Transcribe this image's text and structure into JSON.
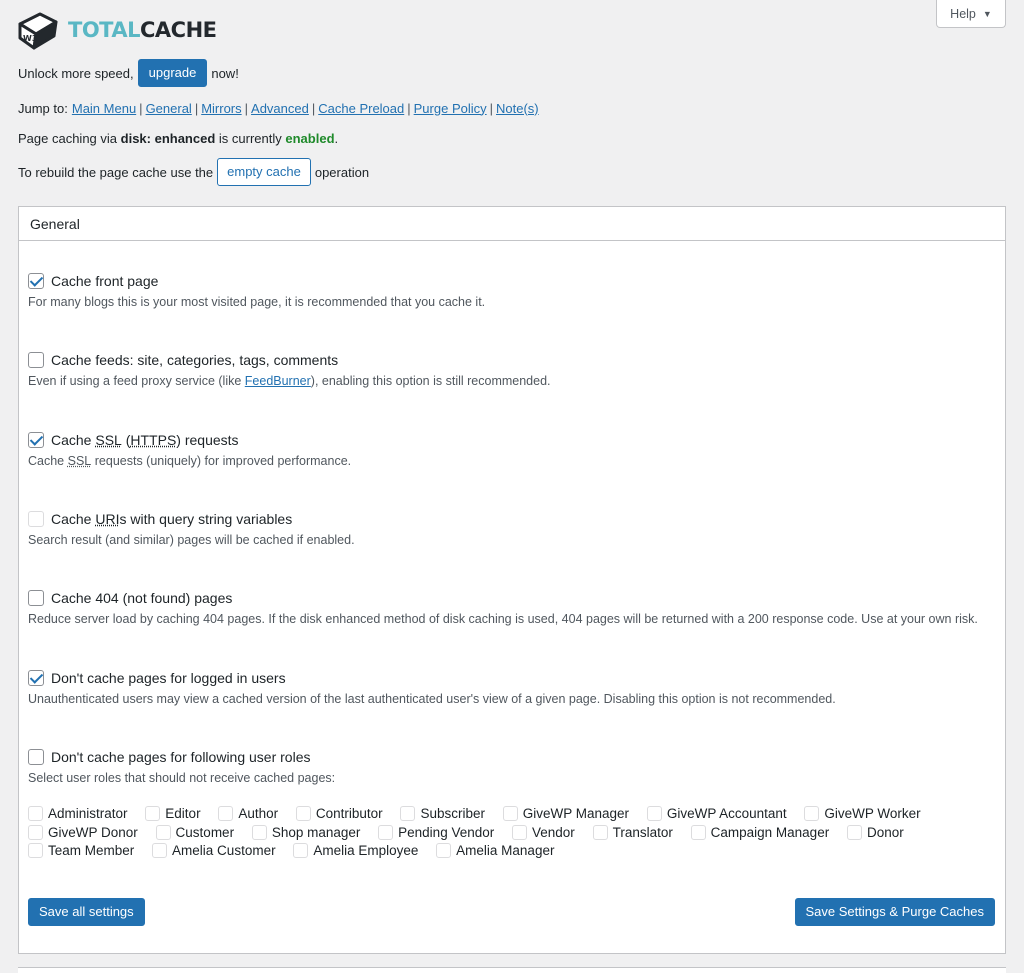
{
  "brand": {
    "total": "TOTAL",
    "cache": "CACHE",
    "badge": "W3"
  },
  "help": {
    "label": "Help"
  },
  "promo": {
    "before": "Unlock more speed,",
    "button": "upgrade",
    "after": "now!"
  },
  "jump": {
    "label": "Jump to:",
    "links": [
      "Main Menu",
      "General",
      "Mirrors",
      "Advanced",
      "Cache Preload",
      "Purge Policy",
      "Note(s)"
    ]
  },
  "status": {
    "prefix": "Page caching via",
    "method": "disk: enhanced",
    "middle": "is currently",
    "state": "enabled",
    "suffix": "."
  },
  "rebuild": {
    "before": "To rebuild the page cache use the",
    "button": "empty cache",
    "after": "operation"
  },
  "panel": {
    "title": "General"
  },
  "options": {
    "front": {
      "label": "Cache front page",
      "desc": "For many blogs this is your most visited page, it is recommended that you cache it."
    },
    "feeds": {
      "label": "Cache feeds: site, categories, tags, comments",
      "desc_before": "Even if using a feed proxy service (like",
      "desc_link": "FeedBurner",
      "desc_after": "), enabling this option is still recommended."
    },
    "ssl": {
      "label_a": "Cache",
      "abbr1": "SSL",
      "label_b": "(",
      "abbr2": "HTTPS",
      "label_c": ") requests",
      "desc_a": "Cache",
      "desc_abbr": "SSL",
      "desc_b": "requests (uniquely) for improved performance."
    },
    "uris": {
      "label_a": "Cache",
      "abbr": "URI",
      "label_b": "s with query string variables",
      "desc": "Search result (and similar) pages will be cached if enabled."
    },
    "e404": {
      "label": "Cache 404 (not found) pages",
      "desc": "Reduce server load by caching 404 pages. If the disk enhanced method of disk caching is used, 404 pages will be returned with a 200 response code. Use at your own risk."
    },
    "logged": {
      "label": "Don't cache pages for logged in users",
      "desc": "Unauthenticated users may view a cached version of the last authenticated user's view of a given page. Disabling this option is not recommended."
    },
    "roles": {
      "label": "Don't cache pages for following user roles",
      "desc": "Select user roles that should not receive cached pages:"
    }
  },
  "roles": [
    "Administrator",
    "Editor",
    "Author",
    "Contributor",
    "Subscriber",
    "GiveWP Manager",
    "GiveWP Accountant",
    "GiveWP Worker",
    "GiveWP Donor",
    "Customer",
    "Shop manager",
    "Pending Vendor",
    "Vendor",
    "Translator",
    "Campaign Manager",
    "Donor",
    "Team Member",
    "Amelia Customer",
    "Amelia Employee",
    "Amelia Manager"
  ],
  "buttons": {
    "save": "Save all settings",
    "save_purge": "Save Settings & Purge Caches"
  },
  "colors": {
    "primary": "#2271b1",
    "enabled": "#1f8a2b",
    "logo_teal": "#5ab7c4"
  }
}
